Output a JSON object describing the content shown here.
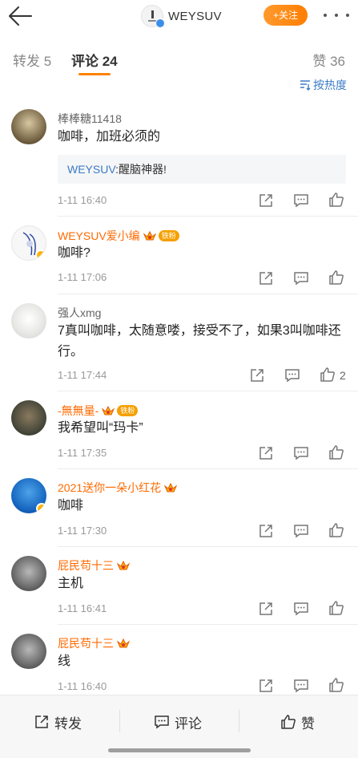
{
  "header": {
    "account_name": "WEYSUV",
    "follow_label": "+关注",
    "icons": [
      "back-arrow-icon",
      "more-icon"
    ]
  },
  "tabs": [
    {
      "label": "转发 5",
      "active": false
    },
    {
      "label": "评论 24",
      "active": true
    },
    {
      "label": "赞 36",
      "active": false
    }
  ],
  "sort_label": "按热度",
  "comments": [
    {
      "name": "棒棒糖11418",
      "text": "咖啡，加班必须的",
      "reply_name": "WEYSUV",
      "reply_text": ":醒脑神器!",
      "time": "1-11 16:40",
      "likes": ""
    },
    {
      "name": "WEYSUV爱小编",
      "fan_badge": "铁粉",
      "text": "咖啡?",
      "time": "1-11 17:06",
      "likes": ""
    },
    {
      "name": "强人xmg",
      "text": "7真叫咖啡，太随意喽，接受不了，如果3叫咖啡还行。",
      "time": "1-11 17:44",
      "likes": "2"
    },
    {
      "name": "-無無量-",
      "fan_badge": "铁粉",
      "text": "我希望叫“玛卡”",
      "time": "1-11 17:35",
      "likes": ""
    },
    {
      "name": "2021送你一朵小红花",
      "text": "咖啡",
      "time": "1-11 17:30",
      "likes": ""
    },
    {
      "name": "屁民苟十三",
      "text": "主机",
      "time": "1-11 16:41",
      "likes": ""
    },
    {
      "name": "屁民苟十三",
      "text": "线",
      "time": "1-11 16:40",
      "likes": ""
    }
  ],
  "bottom_bar": {
    "repost_label": "转发",
    "comment_label": "评论",
    "like_label": "赞"
  },
  "colors": {
    "accent": "#ff8200",
    "link": "#3b7cc7",
    "vip_name": "#ff6a00"
  }
}
